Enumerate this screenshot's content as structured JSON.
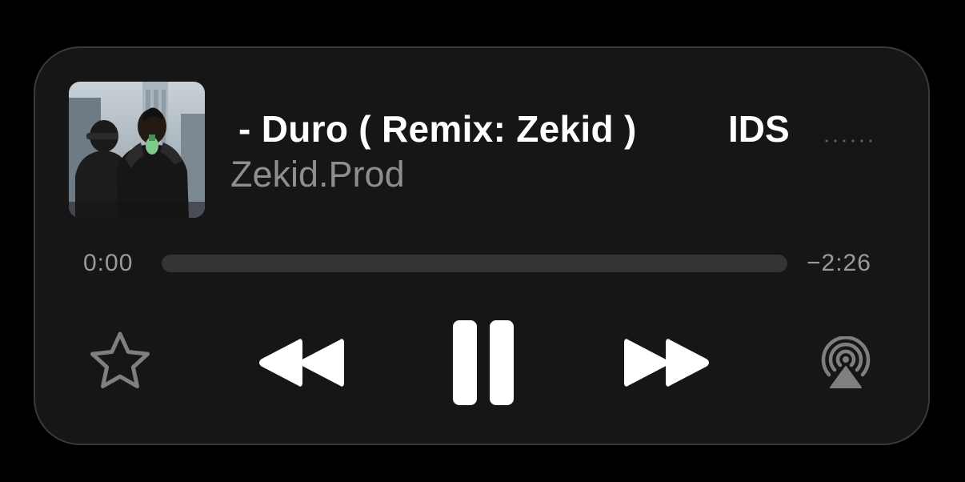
{
  "now_playing": {
    "title": "- Duro ( Remix: Zekid )",
    "title_continued": "IDS",
    "artist": "Zekid.Prod"
  },
  "playback": {
    "elapsed": "0:00",
    "remaining": "−2:26",
    "progress_fraction": 0.0,
    "state": "playing"
  },
  "icons": {
    "artwork": "album-artwork",
    "more": "more-dots-icon",
    "favorite": "star-icon",
    "previous": "rewind-icon",
    "play_pause": "pause-icon",
    "next": "fast-forward-icon",
    "output": "airplay-audio-icon"
  },
  "colors": {
    "background": "#000000",
    "card": "#161616",
    "card_border": "#3a3a3a",
    "primary_text": "#ffffff",
    "secondary_text": "#8e8e8e",
    "progress_track": "#343434"
  }
}
